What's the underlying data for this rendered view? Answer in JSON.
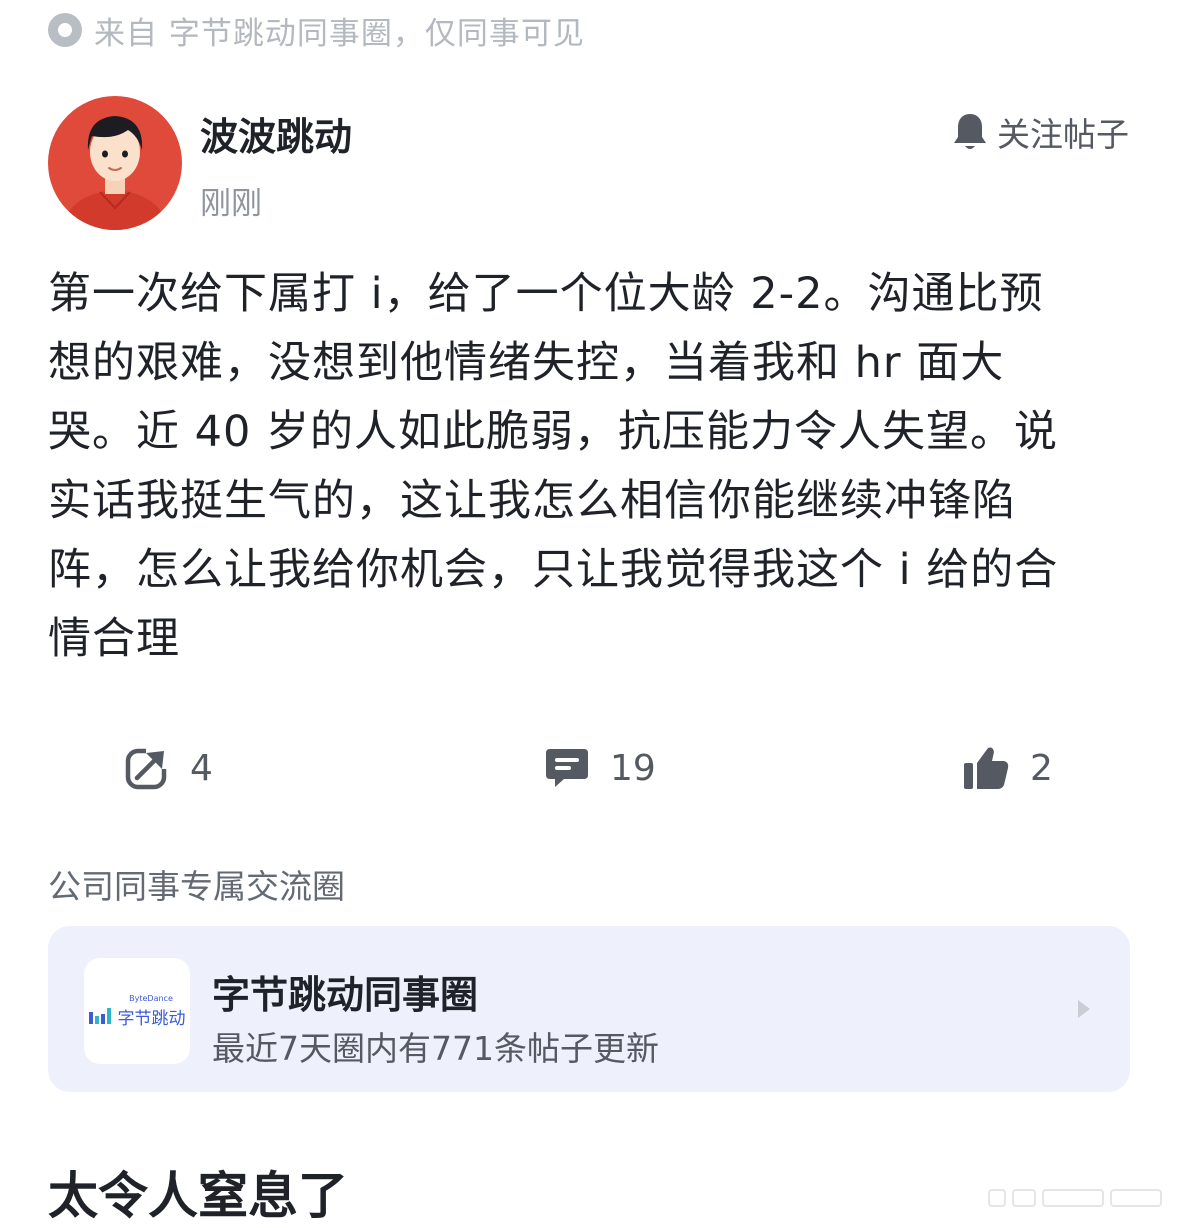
{
  "source": {
    "text": "来自 字节跳动同事圈，仅同事可见",
    "icon": "circle-badge-icon"
  },
  "author": {
    "name": "波波跳动",
    "time": "刚刚",
    "avatar_color": "#e04a3a"
  },
  "follow": {
    "label": "关注帖子",
    "icon": "bell-icon"
  },
  "post": {
    "body": "第一次给下属打 i，给了一个位大龄 2-2。沟通比预\n想的艰难，没想到他情绪失控，当着我和 hr 面大\n哭。近 40 岁的人如此脆弱，抗压能力令人失望。说\n实话我挺生气的，这让我怎么相信你能继续冲锋陷\n阵，怎么让我给你机会，只让我觉得我这个 i 给的合\n情合理"
  },
  "actions": {
    "share": {
      "icon": "share-icon",
      "count": "4"
    },
    "comment": {
      "icon": "comment-icon",
      "count": "19"
    },
    "like": {
      "icon": "thumbs-up-icon",
      "count": "2"
    }
  },
  "section": {
    "title": "公司同事专属交流圈"
  },
  "circle": {
    "logo_en": "ByteDance",
    "logo_cn": "字节跳动",
    "name": "字节跳动同事圈",
    "desc": "最近7天圈内有771条帖子更新",
    "accent": "#3b5bd9",
    "background": "#eef0fb"
  },
  "caption": "太令人窒息了"
}
